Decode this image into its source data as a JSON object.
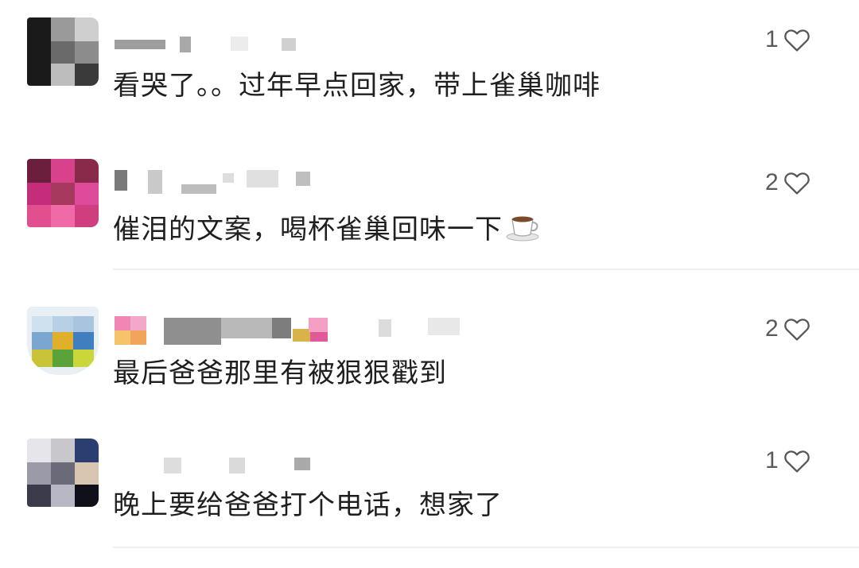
{
  "comments": [
    {
      "text": "看哭了。。过年早点回家，带上雀巢咖啡",
      "likes": "1"
    },
    {
      "text": "催泪的文案，喝杯雀巢回味一下",
      "likes": "2",
      "emoji": "coffee-cup-icon"
    },
    {
      "text": "最后爸爸那里有被狠狠戳到",
      "likes": "2"
    },
    {
      "text": "晚上要给爸爸打个电话，想家了",
      "likes": "1"
    }
  ],
  "icons": {
    "like": "heart-outline-icon"
  },
  "colors": {
    "text": "#1f1f1f",
    "like_count": "#5a5a5a",
    "divider": "#efefef"
  }
}
